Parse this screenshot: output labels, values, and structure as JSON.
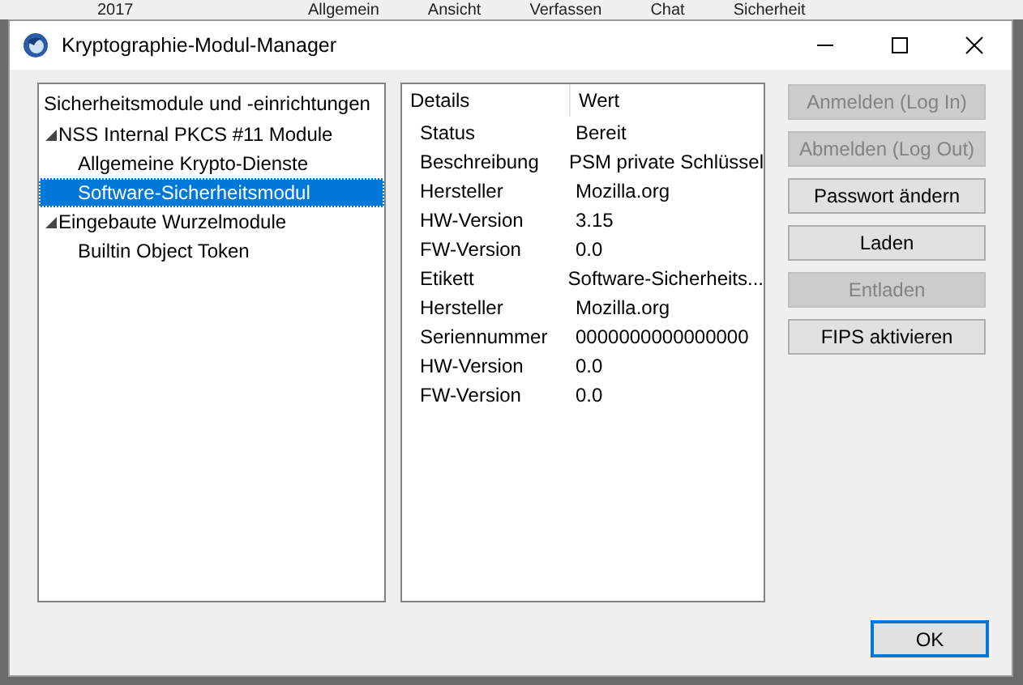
{
  "background_window": {
    "item": "2017",
    "tabs": [
      "Allgemein",
      "Ansicht",
      "Verfassen",
      "Chat",
      "Sicherheit"
    ]
  },
  "window": {
    "title": "Kryptographie-Modul-Manager"
  },
  "tree": {
    "header": "Sicherheitsmodule und -einrichtungen",
    "items": [
      {
        "label": "NSS Internal PKCS #11 Module",
        "expanded": true,
        "selected": false,
        "children": [
          {
            "label": "Allgemeine Krypto-Dienste",
            "selected": false
          },
          {
            "label": "Software-Sicherheitsmodul",
            "selected": true
          }
        ]
      },
      {
        "label": "Eingebaute Wurzelmodule",
        "expanded": true,
        "selected": false,
        "children": [
          {
            "label": "Builtin Object Token",
            "selected": false
          }
        ]
      }
    ]
  },
  "details": {
    "columns": [
      "Details",
      "Wert"
    ],
    "rows": [
      [
        "Status",
        "Bereit"
      ],
      [
        "Beschreibung",
        "PSM private Schlüssel"
      ],
      [
        "Hersteller",
        "Mozilla.org"
      ],
      [
        "HW-Version",
        "3.15"
      ],
      [
        "FW-Version",
        "0.0"
      ],
      [
        "Etikett",
        "Software-Sicherheits..."
      ],
      [
        "Hersteller",
        "Mozilla.org"
      ],
      [
        "Seriennummer",
        "0000000000000000"
      ],
      [
        "HW-Version",
        "0.0"
      ],
      [
        "FW-Version",
        "0.0"
      ]
    ]
  },
  "buttons": [
    {
      "label": "Anmelden (Log In)",
      "disabled": true
    },
    {
      "label": "Abmelden (Log Out)",
      "disabled": true
    },
    {
      "label": "Passwort ändern",
      "disabled": false
    },
    {
      "label": "Laden",
      "disabled": false
    },
    {
      "label": "Entladen",
      "disabled": true
    },
    {
      "label": "FIPS aktivieren",
      "disabled": false
    }
  ],
  "ok_button": {
    "label": "OK"
  }
}
